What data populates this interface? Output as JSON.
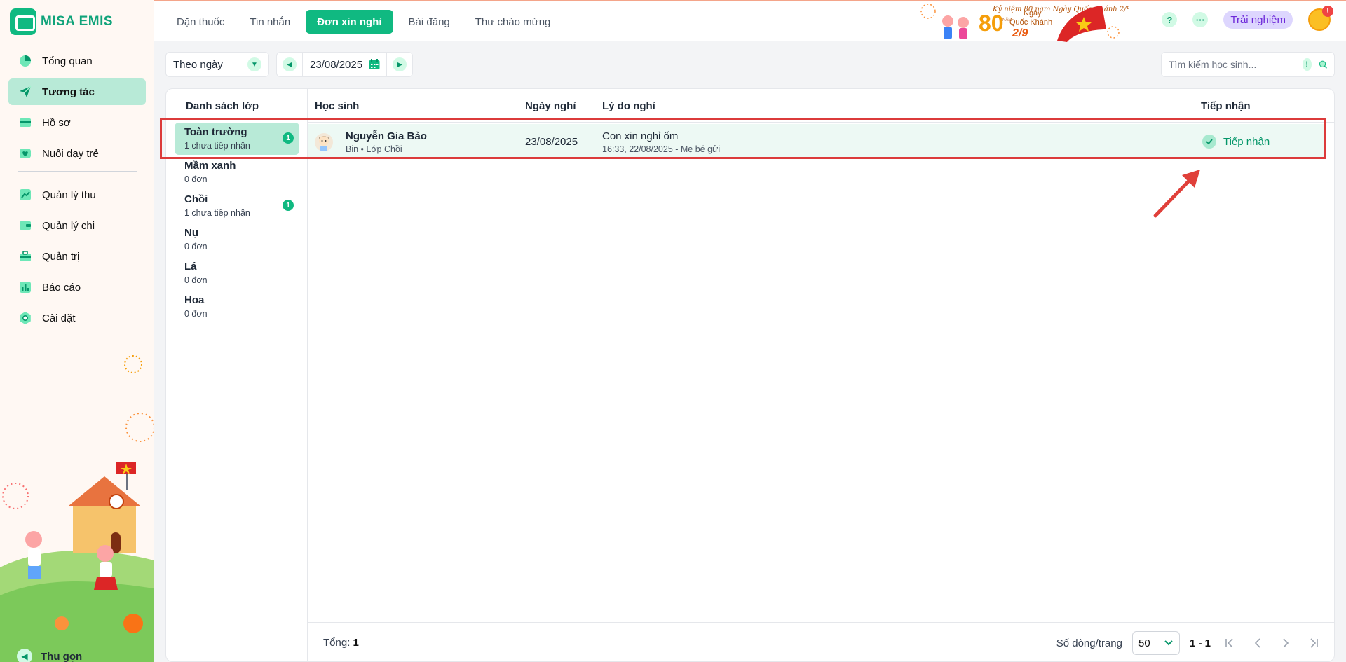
{
  "app": {
    "logo_text": "MISA EMIS",
    "accent": "#10b981",
    "banner_alt": "Kỷ niệm 80 năm Ngày Quốc Khánh 2/9"
  },
  "sidebar": {
    "items": [
      {
        "label": "Tổng quan",
        "icon": "pie-chart-icon"
      },
      {
        "label": "Tương tác",
        "icon": "paper-plane-icon",
        "active": true
      },
      {
        "label": "Hồ sơ",
        "icon": "folder-icon"
      },
      {
        "label": "Nuôi dạy trẻ",
        "icon": "heart-icon"
      },
      {
        "label": "Quản lý thu",
        "icon": "trend-up-icon"
      },
      {
        "label": "Quản lý chi",
        "icon": "wallet-icon"
      },
      {
        "label": "Quản trị",
        "icon": "briefcase-icon"
      },
      {
        "label": "Báo cáo",
        "icon": "bar-chart-icon"
      },
      {
        "label": "Cài đặt",
        "icon": "gear-icon"
      }
    ],
    "collapse_label": "Thu gọn"
  },
  "topbar": {
    "tabs": [
      "Dặn thuốc",
      "Tin nhắn",
      "Đơn xin nghỉ",
      "Bài đăng",
      "Thư chào mừng"
    ],
    "active_tab": 2,
    "banner": {
      "small": "Kỷ niệm",
      "number": "80",
      "unit": "NĂM",
      "line1": "Ngày",
      "line2": "Quốc Khánh",
      "date": "2/9"
    },
    "help": "?",
    "more": "···",
    "trial_label": "Trải nghiệm",
    "avatar_badge": "!"
  },
  "filter": {
    "mode_value": "Theo ngày",
    "date_value": "23/08/2025",
    "search_placeholder": "Tìm kiếm học sinh...",
    "search_info": "!"
  },
  "classes": {
    "header": "Danh sách lớp",
    "items": [
      {
        "name": "Toàn trường",
        "sub": "1 chưa tiếp nhận",
        "badge": "1",
        "active": true
      },
      {
        "name": "Mầm xanh",
        "sub": "0 đơn",
        "badge": ""
      },
      {
        "name": "Chồi",
        "sub": "1 chưa tiếp nhận",
        "badge": "1"
      },
      {
        "name": "Nụ",
        "sub": "0 đơn",
        "badge": ""
      },
      {
        "name": "Lá",
        "sub": "0 đơn",
        "badge": ""
      },
      {
        "name": "Hoa",
        "sub": "0 đơn",
        "badge": ""
      }
    ]
  },
  "table": {
    "columns": {
      "student": "Học sinh",
      "date": "Ngày nghỉ",
      "reason": "Lý do nghỉ",
      "accept": "Tiếp nhận"
    },
    "rows": [
      {
        "student_name": "Nguyễn Gia Bảo",
        "student_sub": "Bin • Lớp Chồi",
        "date": "23/08/2025",
        "reason": "Con xin nghỉ ốm",
        "reason_sub": "16:33, 22/08/2025 - Mẹ bé gửi",
        "accept_label": "Tiếp nhận"
      }
    ]
  },
  "footer": {
    "total_label": "Tổng:",
    "total_value": "1",
    "rows_per_page_label": "Số dòng/trang",
    "rows_per_page_value": "50",
    "range": "1 - 1"
  }
}
